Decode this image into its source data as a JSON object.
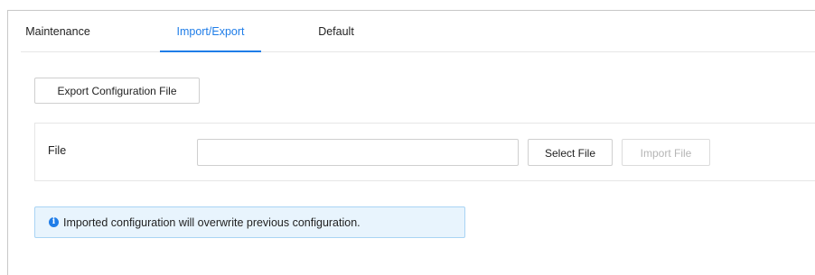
{
  "tabs": [
    {
      "label": "Maintenance",
      "active": false
    },
    {
      "label": "Import/Export",
      "active": true
    },
    {
      "label": "Default",
      "active": false
    }
  ],
  "export": {
    "button_label": "Export Configuration File"
  },
  "import_form": {
    "file_label": "File",
    "file_input_value": "",
    "select_file_label": "Select File",
    "import_file_label": "Import File",
    "import_file_enabled": false
  },
  "notice": {
    "icon": "info-icon",
    "text": "Imported configuration will overwrite previous configuration."
  },
  "colors": {
    "accent": "#1f7de8",
    "notice_bg": "#e8f4fd",
    "notice_border": "#a9d4f4"
  }
}
